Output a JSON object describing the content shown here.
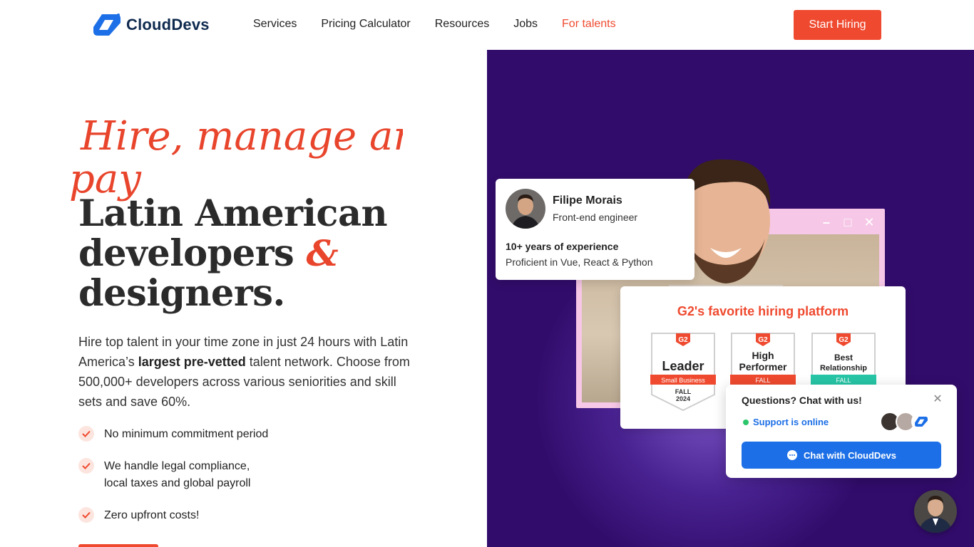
{
  "header": {
    "logo_text": "CloudDevs",
    "nav": [
      "Services",
      "Pricing Calculator",
      "Resources",
      "Jobs",
      "For talents"
    ],
    "cta": "Start Hiring"
  },
  "hero": {
    "script_line1": "Hire, manage and",
    "script_line2": "pay",
    "headline_line1": "Latin American",
    "headline_line2": "developers",
    "headline_amp": "&",
    "headline_line3": "designers.",
    "desc_part1": "Hire top talent in your time zone in just 24 hours with Latin America’s ",
    "desc_bold": "largest pre-vetted",
    "desc_part2": " talent network. Choose from 500,000+ developers across various seniorities and skill sets and save 60%.",
    "checks": [
      "No minimum commitment period",
      "We handle legal compliance,",
      "local taxes and global payroll",
      "Zero upfront costs!"
    ]
  },
  "profile": {
    "name": "Filipe Morais",
    "role": "Front-end engineer",
    "experience": "10+ years of experience",
    "skills": "Proficient in Vue, React & Python"
  },
  "g2": {
    "title": "G2's favorite hiring platform",
    "badges": [
      {
        "line1": "Leader",
        "ribbon": "Small Business",
        "season": "FALL",
        "year": "2024"
      },
      {
        "line1": "High",
        "line2": "Performer",
        "ribbon": "FALL"
      },
      {
        "line1": "Best",
        "line2": "Relationship",
        "ribbon": "FALL"
      }
    ],
    "colors": {
      "red": "#ef4a2f",
      "teal": "#27c6a6"
    }
  },
  "chat": {
    "title": "Questions? Chat with us!",
    "status": "Support is online",
    "button": "Chat with CloudDevs"
  },
  "colors": {
    "accent": "#ef4a2f",
    "purple": "#320c6b",
    "chat_blue": "#1c6fe6"
  }
}
